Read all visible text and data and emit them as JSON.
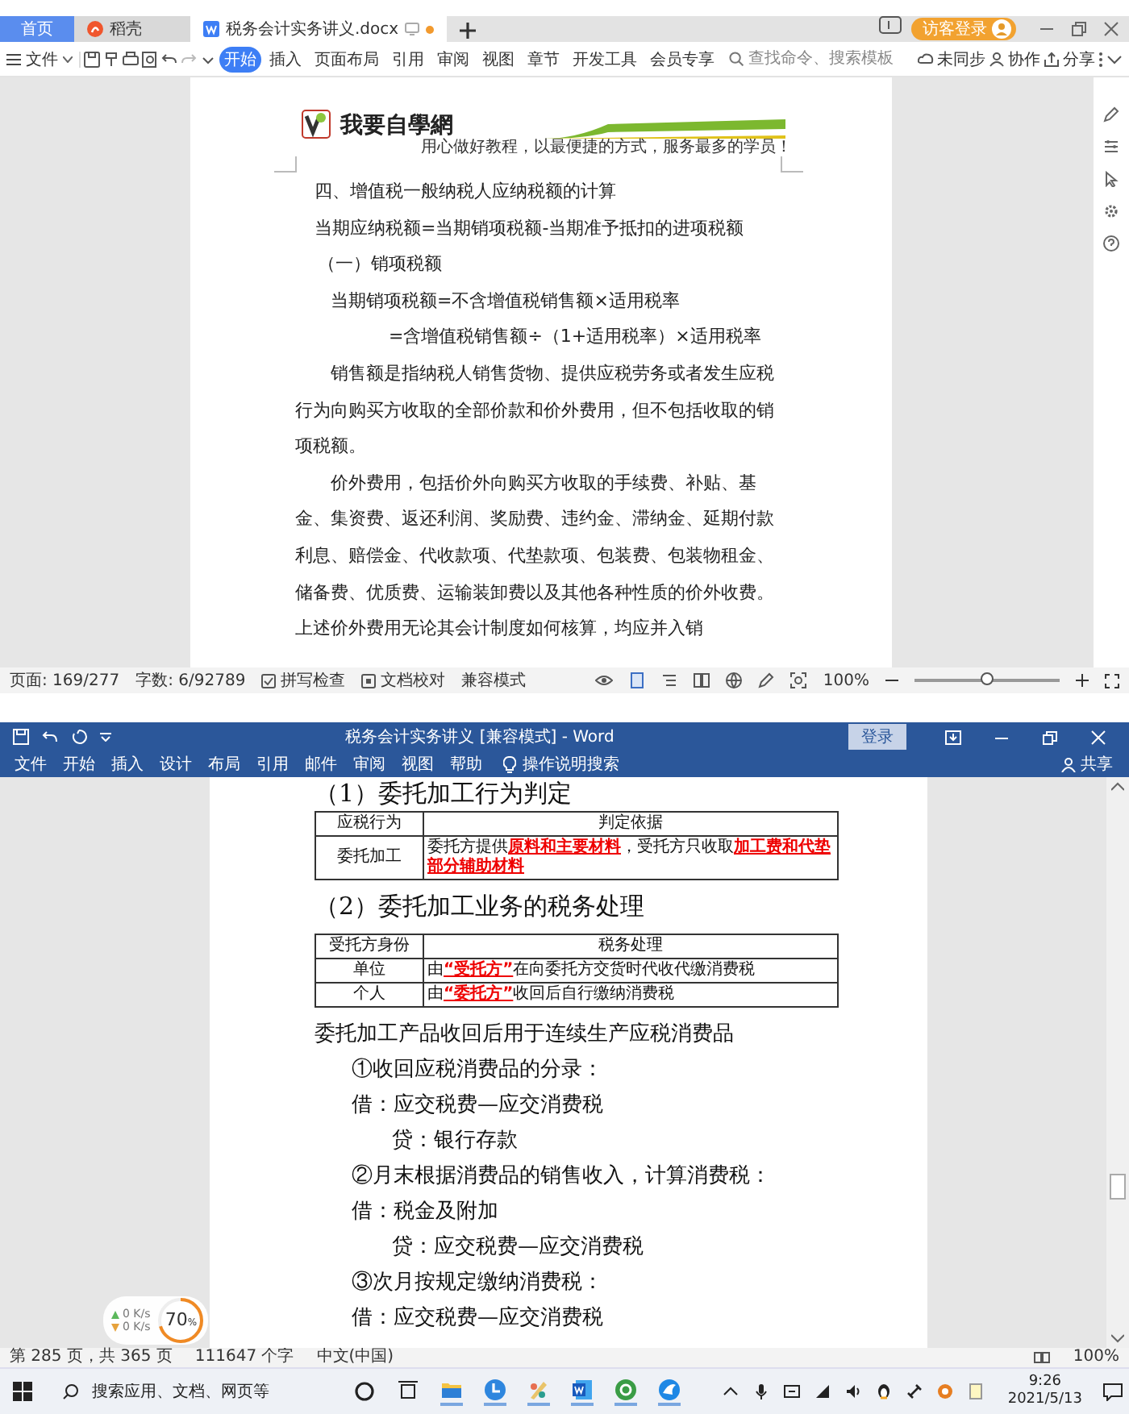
{
  "wps": {
    "tabs": [
      {
        "label": "首页",
        "kind": "home",
        "selected": false
      },
      {
        "label": "稻壳",
        "kind": "docer",
        "selected": false
      },
      {
        "label": "税务会计实务讲义.docx",
        "kind": "doc",
        "selected": true
      }
    ],
    "login_button": "访客登录",
    "toolbar": {
      "file_menu": "文件",
      "ribbon_tabs": [
        {
          "label": "开始",
          "selected": true
        },
        {
          "label": "插入",
          "selected": false
        },
        {
          "label": "页面布局",
          "selected": false
        },
        {
          "label": "引用",
          "selected": false
        },
        {
          "label": "审阅",
          "selected": false
        },
        {
          "label": "视图",
          "selected": false
        },
        {
          "label": "章节",
          "selected": false
        },
        {
          "label": "开发工具",
          "selected": false
        },
        {
          "label": "会员专享",
          "selected": false
        }
      ],
      "search": {
        "placeholder": "查找命令、搜索模板"
      },
      "actions": [
        {
          "label": "未同步",
          "kind": "sync"
        },
        {
          "label": "协作",
          "kind": "collab"
        },
        {
          "label": "分享",
          "kind": "share"
        }
      ]
    },
    "document": {
      "header": {
        "logo_text": "我要自學網",
        "tagline": "用心做好教程，以最便捷的方式，服务最多的学员！"
      },
      "paragraphs": [
        {
          "kind": "heading",
          "text": "四、增值税一般纳税人应纳税额的计算"
        },
        {
          "kind": "formula_main",
          "text": "当期应纳税额=当期销项税额-当期准予抵扣的进项税额"
        },
        {
          "kind": "subheading",
          "text": "（一）销项税额"
        },
        {
          "kind": "formula",
          "text": "当期销项税额=不含增值税销售额×适用税率"
        },
        {
          "kind": "formula_cont",
          "text": "=含增值税销售额÷（1+适用税率）×适用税率"
        },
        {
          "kind": "body",
          "text": "销售额是指纳税人销售货物、提供应税劳务或者发生应税行为向购买方收取的全部价款和价外费用，但不包括收取的销项税额。"
        },
        {
          "kind": "body",
          "text": "价外费用，包括价外向购买方收取的手续费、补贴、基金、集资费、返还利润、奖励费、违约金、滞纳金、延期付款利息、赔偿金、代收款项、代垫款项、包装费、包装物租金、储备费、优质费、运输装卸费以及其他各种性质的价外收费。上述价外费用无论其会计制度如何核算，均应并入销"
        }
      ]
    },
    "status_bar": {
      "page": "页面: 169/277",
      "words": "字数: 6/92789",
      "toggles": [
        {
          "label": "拼写检查",
          "checked": true
        },
        {
          "label": "文档校对",
          "checked": false
        }
      ],
      "mode": "兼容模式",
      "zoom": "100%",
      "zoom_slider": {
        "level": 0.5
      }
    }
  },
  "word": {
    "title": "税务会计实务讲义 [兼容模式] - Word",
    "login_button": "登录",
    "menu": [
      "文件",
      "开始",
      "插入",
      "设计",
      "布局",
      "引用",
      "邮件",
      "审阅",
      "视图",
      "帮助"
    ],
    "tell_me": "操作说明搜索",
    "share": "共享",
    "document": {
      "blocks": [
        {
          "kind": "heading",
          "text": "（1）委托加工行为判定"
        },
        {
          "kind": "table",
          "columns": [
            "应税行为",
            "判定依据"
          ],
          "rows": [
            [
              "委托加工",
              "委托方提供**原料和主要材料**，受托方只收取**加工费和代垫部分辅助材料**"
            ]
          ]
        },
        {
          "kind": "heading",
          "text": "（2）委托加工业务的税务处理"
        },
        {
          "kind": "table",
          "columns": [
            "受托方身份",
            "税务处理"
          ],
          "rows": [
            [
              "单位",
              "由**“受托方”**在向委托方交货时代收代缴消费税"
            ],
            [
              "个人",
              "由**“委托方”**收回后自行缴纳消费税"
            ]
          ]
        },
        {
          "kind": "text",
          "text": "委托加工产品收回后用于连续生产应税消费品"
        },
        {
          "kind": "entry",
          "text": "①收回应税消费品的分录："
        },
        {
          "kind": "entry",
          "text": "借：应交税费—应交消费税"
        },
        {
          "kind": "contra",
          "text": "贷：银行存款"
        },
        {
          "kind": "entry",
          "text": "②月末根据消费品的销售收入，计算消费税："
        },
        {
          "kind": "entry",
          "text": "借：税金及附加"
        },
        {
          "kind": "contra",
          "text": "贷：应交税费—应交消费税"
        },
        {
          "kind": "entry",
          "text": "③次月按规定缴纳消费税："
        },
        {
          "kind": "entry",
          "text": "借：应交税费—应交消费税"
        }
      ]
    },
    "status_bar": {
      "page": "第 285 页，共 365 页",
      "words": "111647 个字",
      "language": "中文(中国)",
      "zoom": "100%"
    }
  },
  "speed_widget": {
    "upload": "0 K/s",
    "download": "0 K/s",
    "percent": "70",
    "percent_unit": "%",
    "level": 0.7
  },
  "taskbar": {
    "search": {
      "placeholder": "搜索应用、文档、网页等"
    },
    "time": "9:26",
    "date": "2021/5/13"
  }
}
